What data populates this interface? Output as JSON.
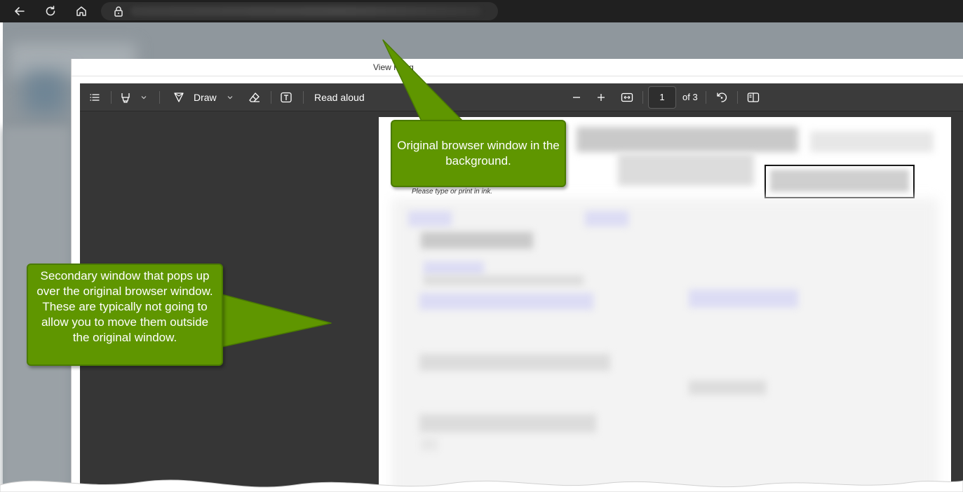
{
  "browser": {
    "back_icon": "back-arrow-icon",
    "refresh_icon": "refresh-icon",
    "home_icon": "home-icon",
    "lock_icon": "lock-icon"
  },
  "popup": {
    "title": "View Filing"
  },
  "pdf_toolbar": {
    "read_aloud_label": "Read aloud",
    "draw_label": "Draw",
    "page_number": "1",
    "page_total": "of 3"
  },
  "pdf_page": {
    "ink_note": "Please type or print in ink."
  },
  "callouts": {
    "top": "Original browser window in the background.",
    "left": "Secondary window that pops up over the original browser window. These are typically not going to allow you to move them outside the original window."
  },
  "colors": {
    "callout_green": "#5f9600",
    "chrome_dark": "#202020",
    "viewer_dark": "#363636"
  }
}
